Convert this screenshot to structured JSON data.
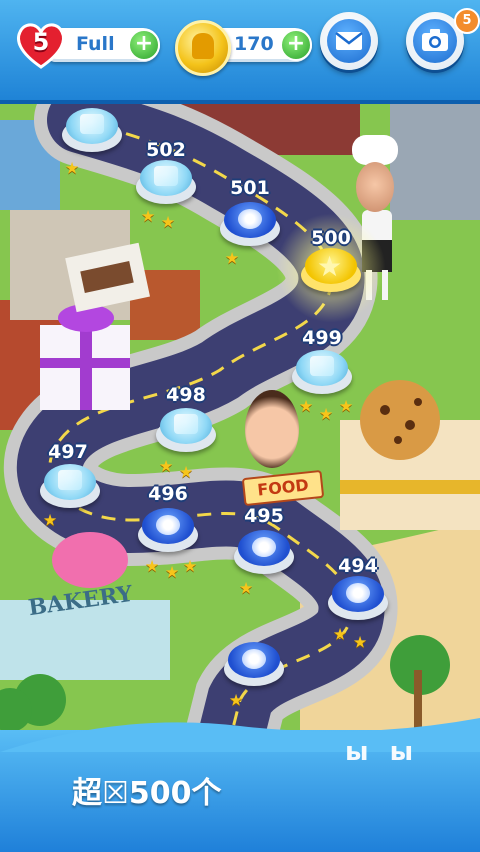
{
  "hud": {
    "lives_count": "5",
    "lives_status": "Full",
    "coins": "170",
    "notification_count": "5"
  },
  "levels": [
    {
      "label": "502",
      "type": "ice",
      "stars": 2
    },
    {
      "label": "501",
      "type": "blue",
      "stars": 1
    },
    {
      "label": "500",
      "type": "gold",
      "stars": 0
    },
    {
      "label": "499",
      "type": "ice",
      "stars": 3
    },
    {
      "label": "498",
      "type": "ice",
      "stars": 2
    },
    {
      "label": "497",
      "type": "ice",
      "stars": 1
    },
    {
      "label": "496",
      "type": "blue",
      "stars": 3
    },
    {
      "label": "495",
      "type": "blue",
      "stars": 1
    },
    {
      "label": "494",
      "type": "blue",
      "stars": 2
    }
  ],
  "food_sign": "FOOD",
  "bakery_sign": "BAKERY",
  "banner": {
    "text": "超☒500个",
    "deco": "ы ы"
  },
  "colors": {
    "hud_blue": "#1f83d6",
    "road": "#3d3f72",
    "grass": "#7fc24a",
    "gold": "#f3c400"
  },
  "icons": [
    "heart-icon",
    "plus-icon",
    "coin-icon",
    "mail-icon",
    "camera-icon",
    "star-icon",
    "gift-icon",
    "cookie-icon"
  ]
}
